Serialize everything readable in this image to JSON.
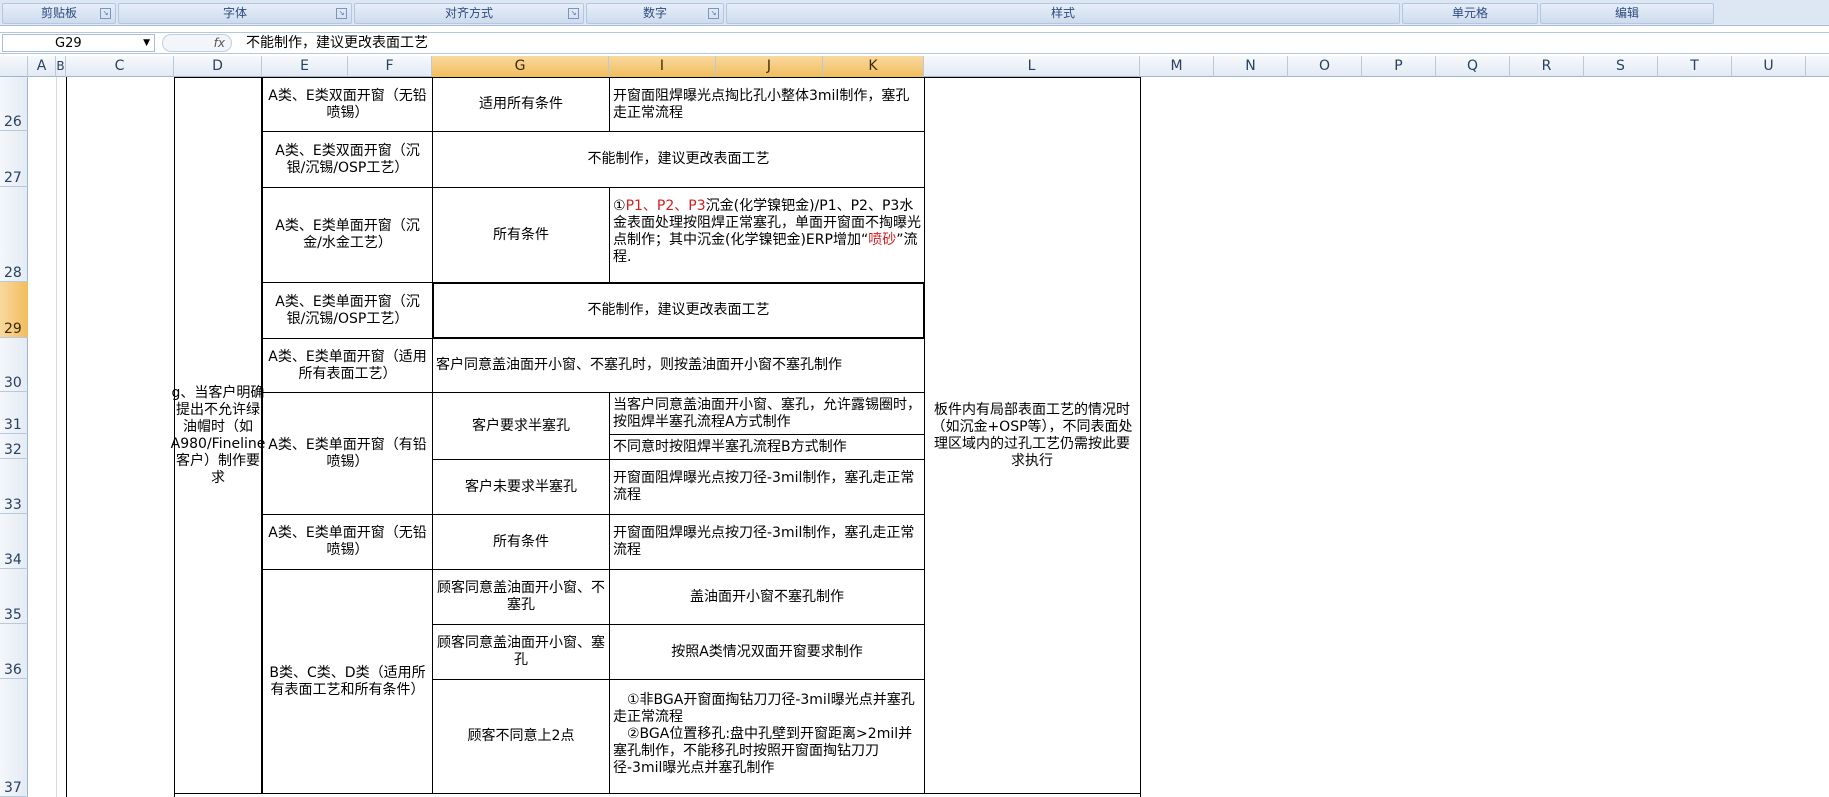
{
  "ribbon": {
    "groups": [
      "剪贴板",
      "字体",
      "对齐方式",
      "数字",
      "样式",
      "单元格",
      "编辑"
    ]
  },
  "formula_bar": {
    "name_box": "G29",
    "fx": "fx",
    "value": "不能制作，建议更改表面工艺"
  },
  "columns": [
    "A",
    "B",
    "C",
    "D",
    "E",
    "F",
    "G",
    "I",
    "J",
    "K",
    "L",
    "M",
    "N",
    "O",
    "P",
    "Q",
    "R",
    "S",
    "T",
    "U"
  ],
  "rows": [
    "26",
    "27",
    "28",
    "29",
    "30",
    "31",
    "32",
    "33",
    "34",
    "35",
    "36",
    "37"
  ],
  "sheet": {
    "d_block": "g、当客户明确提出不允许绿油帽时（如A980/Fineline客户）制作要求",
    "l_block": "板件内有局部表面工艺的情况时（如沉金+OSP等），不同表面处理区域内的过孔工艺仍需按此要求执行",
    "r26": {
      "e": "A类、E类双面开窗（无铅喷锡）",
      "g": "适用所有条件",
      "ik": "开窗面阻焊曝光点掏比孔小整体3mil制作，塞孔走正常流程"
    },
    "r27": {
      "e": "A类、E类双面开窗（沉银/沉锡/OSP工艺）",
      "gk": "不能制作，建议更改表面工艺"
    },
    "r28": {
      "e": "A类、E类单面开窗（沉金/水金工艺）",
      "g": "所有条件",
      "ik_a": "①",
      "ik_red1": "P1、P2、P3",
      "ik_b": "沉金(化学镍钯金)/P1、P2、P3水金表面处理按阻焊正常塞孔，单面开窗面不掏曝光点制作；其中沉金(化学镍钯金)ERP增加“",
      "ik_red2": "喷砂",
      "ik_c": "”流程."
    },
    "r29": {
      "e": "A类、E类单面开窗（沉银/沉锡/OSP工艺）",
      "gk": "不能制作，建议更改表面工艺"
    },
    "r30": {
      "e": "A类、E类单面开窗（适用所有表面工艺）",
      "gk": "客户同意盖油面开小窗、不塞孔时，则按盖油面开小窗不塞孔制作"
    },
    "r31_33": {
      "e": "A类、E类单面开窗（有铅喷锡）",
      "g1": "客户要求半塞孔",
      "ik31": "当客户同意盖油面开小窗、塞孔，允许露锡圈时，按阻焊半塞孔流程A方式制作",
      "ik32": "不同意时按阻焊半塞孔流程B方式制作",
      "g2": "客户未要求半塞孔",
      "ik33": "开窗面阻焊曝光点按刀径-3mil制作，塞孔走正常流程"
    },
    "r34": {
      "e": "A类、E类单面开窗（无铅喷锡）",
      "g": "所有条件",
      "ik": "开窗面阻焊曝光点按刀径-3mil制作，塞孔走正常流程"
    },
    "r35_37": {
      "e": "B类、C类、D类（适用所有表面工艺和所有条件）",
      "g35": "顾客同意盖油面开小窗、不塞孔",
      "ik35": "盖油面开小窗不塞孔制作",
      "g36": "顾客同意盖油面开小窗、塞孔",
      "ik36": "按照A类情况双面开窗要求制作",
      "g37": "顾客不同意上2点",
      "ik37a": "①非BGA开窗面掏钻刀刀径-3mil曝光点并塞孔走正常流程",
      "ik37b": "②BGA位置移孔:盘中孔壁到开窗距离>2mil并塞孔制作，不能移孔时按照开窗面掏钻刀刀径-3mil曝光点并塞孔制作"
    }
  }
}
